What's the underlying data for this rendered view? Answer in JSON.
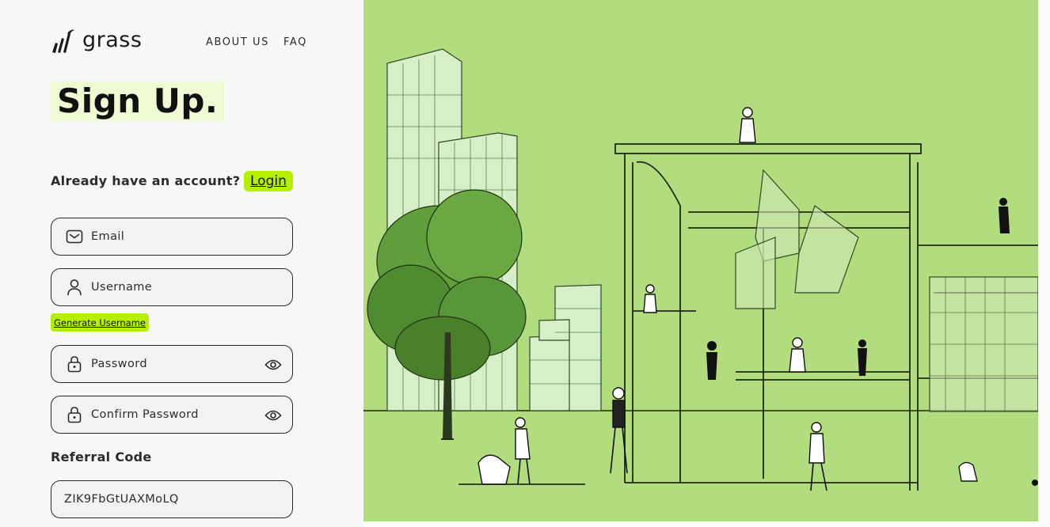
{
  "brand": {
    "name": "grass",
    "icon": "grass-logo-icon"
  },
  "nav": {
    "about": "ABOUT US",
    "faq": "FAQ"
  },
  "page": {
    "title": "Sign Up."
  },
  "account": {
    "prompt": "Already have an account?",
    "login_label": "Login"
  },
  "form": {
    "email": {
      "placeholder": "Email",
      "icon": "mail-icon"
    },
    "username": {
      "placeholder": "Username",
      "icon": "user-icon"
    },
    "generate_label": "Generate Username",
    "password": {
      "placeholder": "Password",
      "icon": "lock-icon",
      "toggle_icon": "eye-icon"
    },
    "confirm_password": {
      "placeholder": "Confirm Password",
      "icon": "lock-icon",
      "toggle_icon": "eye-icon"
    },
    "referral": {
      "label": "Referral Code",
      "value": "ZIK9FbGtUAXMoLQ"
    }
  },
  "illustration": {
    "alt": "city-park-illustration"
  },
  "colors": {
    "accent": "#b5f000",
    "title_highlight": "#effad3",
    "illustration_bg": "#b2dd7e"
  }
}
